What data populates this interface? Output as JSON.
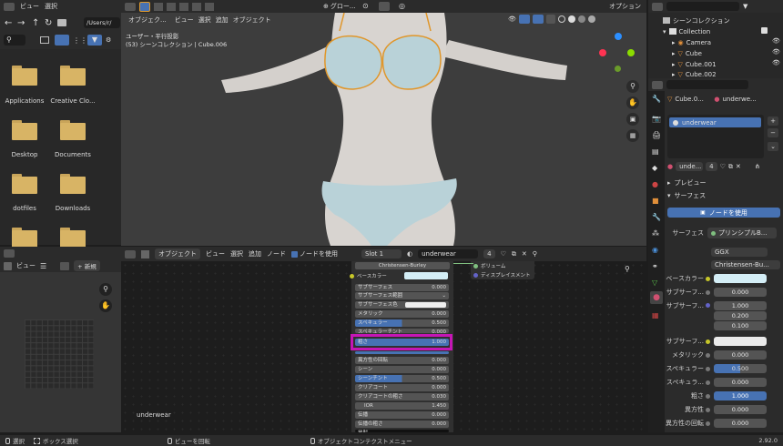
{
  "menubar": {
    "view": "ビュー",
    "select": "選択"
  },
  "filebrowser": {
    "path": "/Users/r/",
    "items": [
      {
        "name": "Applications"
      },
      {
        "name": "Creative Clo..."
      },
      {
        "name": "Desktop"
      },
      {
        "name": "Documents"
      },
      {
        "name": "dotfiles"
      },
      {
        "name": "Downloads"
      }
    ]
  },
  "viewport": {
    "mode": "オブジェク...",
    "menu_view": "ビュー",
    "menu_select": "選択",
    "menu_add": "追加",
    "menu_object": "オブジェクト",
    "transform": "グロー...",
    "info_line1": "ユーザー・平行投影",
    "info_line2": "(53) シーンコレクション | Cube.006",
    "options": "オプション"
  },
  "outliner": {
    "title": "シーンコレクション",
    "items": [
      {
        "name": "Collection"
      },
      {
        "name": "Camera"
      },
      {
        "name": "Cube"
      },
      {
        "name": "Cube.001"
      },
      {
        "name": "Cube.002"
      }
    ]
  },
  "uvpanel": {
    "menu_view": "ビュー",
    "new": "新規"
  },
  "node_editor": {
    "mode": "オブジェクト",
    "menu_view": "ビュー",
    "menu_select": "選択",
    "menu_add": "追加",
    "menu_node": "ノード",
    "use_nodes": "ノードを使用",
    "slot": "Slot 1",
    "material": "underwear",
    "users": "4",
    "footer_label": "underwear",
    "node_title": "Christensen-Burley",
    "base_color": "ベースカラー",
    "rows": [
      {
        "label": "サブサーフェス",
        "value": "0.000"
      },
      {
        "label": "サブサーフェス範囲",
        "value": ""
      },
      {
        "label": "サブサーフェス色",
        "value": ""
      },
      {
        "label": "メタリック",
        "value": "0.000"
      },
      {
        "label": "スペキュラー",
        "value": "0.500"
      },
      {
        "label": "スペキュラーチント",
        "value": "0.000"
      },
      {
        "label": "粗さ",
        "value": "1.000"
      },
      {
        "label": "異方性",
        "value": "0.000"
      },
      {
        "label": "異方性の回転",
        "value": "0.000"
      },
      {
        "label": "シーン",
        "value": "0.000"
      },
      {
        "label": "シーンチント",
        "value": "0.500"
      },
      {
        "label": "クリアコート",
        "value": "0.000"
      },
      {
        "label": "クリアコートの粗さ",
        "value": "0.030"
      },
      {
        "label": "IOR",
        "value": "1.450"
      },
      {
        "label": "伝播",
        "value": "0.000"
      },
      {
        "label": "伝播の粗さ",
        "value": "0.000"
      },
      {
        "label": "放射",
        "value": ""
      }
    ],
    "output_volume": "ボリューム",
    "output_displacement": "ディスプレイスメント"
  },
  "properties": {
    "object_name": "Cube.0...",
    "material_tab": "underwe...",
    "slot_name": "underwear",
    "mat_name": "unde...",
    "mat_users": "4",
    "preview": "プレビュー",
    "surface": "サーフェス",
    "use_nodes": "ノードを使用",
    "surface_label": "サーフェス",
    "surface_value": "プリンシプルB...",
    "distribution": "GGX",
    "subsurface_method": "Christensen-Bu...",
    "base_color": "ベースカラー",
    "subsurface": {
      "label": "サブサーフ...",
      "value": "0.000"
    },
    "subsurface_radius": {
      "label": "サブサーフ...",
      "values": [
        "1.000",
        "0.200",
        "0.100"
      ]
    },
    "subsurface_color": "サブサーフ...",
    "metallic": {
      "label": "メタリック",
      "value": "0.000"
    },
    "specular": {
      "label": "スペキュラー",
      "value": "0.500"
    },
    "specular_tint": {
      "label": "スペキュラ...",
      "value": "0.000"
    },
    "roughness": {
      "label": "粗さ",
      "value": "1.000"
    },
    "anisotropic": {
      "label": "異方性",
      "value": "0.000"
    },
    "anisotropic_rotation": {
      "label": "異方性の回転",
      "value": "0.000"
    }
  },
  "statusbar": {
    "select": "選択",
    "box_select": "ボックス選択",
    "rotate_view": "ビューを回転",
    "context_menu": "オブジェクトコンテクストメニュー",
    "version": "2.92.0"
  },
  "colors": {
    "accent": "#4772b3",
    "highlight": "#c516b5",
    "base_color_swatch": "#d4eef6"
  }
}
